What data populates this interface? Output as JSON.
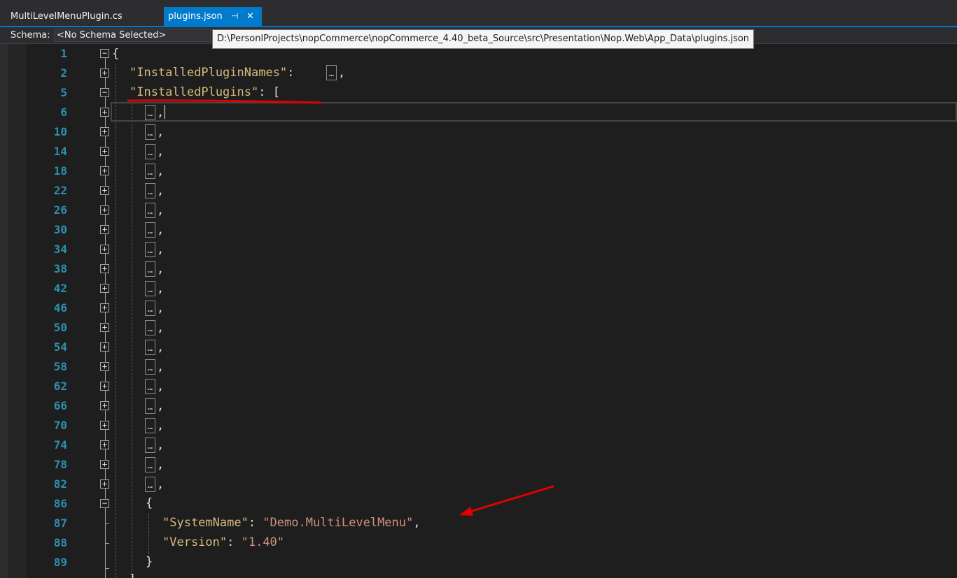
{
  "tabs": [
    {
      "label": "MultiLevelMenuPlugin.cs",
      "active": false
    },
    {
      "label": "plugins.json",
      "active": true
    }
  ],
  "tab_icons": {
    "pin": "pin-icon",
    "close": "close-icon"
  },
  "schema": {
    "label": "Schema:",
    "value": "<No Schema Selected>"
  },
  "tooltip": "D:\\PersonlProjects\\nopCommerce\\nopCommerce_4.40_beta_Source\\src\\Presentation\\Nop.Web\\App_Data\\plugins.json",
  "colors": {
    "accent": "#007acc",
    "line_number": "#2b91af",
    "key": "#d7ba7d",
    "string": "#ce9178",
    "annotation": "#e00000"
  },
  "line_numbers": [
    "1",
    "2",
    "5",
    "6",
    "10",
    "14",
    "18",
    "22",
    "26",
    "30",
    "34",
    "38",
    "42",
    "46",
    "50",
    "54",
    "58",
    "62",
    "66",
    "70",
    "74",
    "78",
    "82",
    "86",
    "87",
    "88",
    "89"
  ],
  "code": {
    "open_brace": "{",
    "installed_plugin_names_key": "\"InstalledPluginNames\"",
    "colon": ": ",
    "ellipsis": "…",
    "comma": ",",
    "installed_plugins_key": "\"InstalledPlugins\"",
    "installed_plugins_tail": ": [",
    "object_open": "{",
    "system_name_key": "\"SystemName\"",
    "system_name_value": "\"Demo.MultiLevelMenu\"",
    "version_key": "\"Version\"",
    "version_value": "\"1.40\"",
    "object_close": "}"
  },
  "collapsed_items_count": 22
}
